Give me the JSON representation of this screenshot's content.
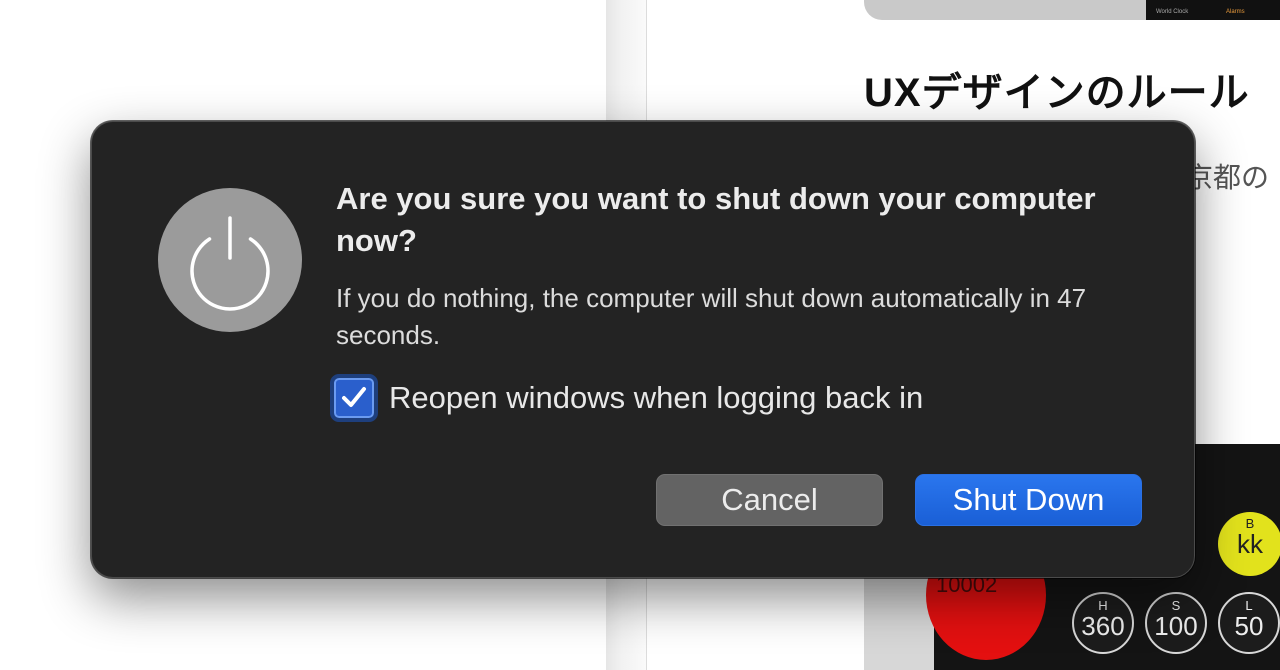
{
  "background": {
    "title": "UXデザインのルール",
    "body_text": "京都の",
    "phone_tabs": [
      "World Clock",
      "Alarms"
    ],
    "app_red_text": "10002",
    "app_circles": [
      {
        "label": "B",
        "value": "kk"
      },
      {
        "label": "H",
        "value": "360"
      },
      {
        "label": "S",
        "value": "100"
      },
      {
        "label": "L",
        "value": "50"
      }
    ]
  },
  "dialog": {
    "icon": "power-icon",
    "title": "Are you sure you want to shut down your computer now?",
    "message": "If you do nothing, the computer will shut down automatically in 47 seconds.",
    "checkbox": {
      "label": "Reopen windows when logging back in",
      "checked": true
    },
    "buttons": {
      "cancel": "Cancel",
      "confirm": "Shut Down"
    }
  },
  "colors": {
    "dialog_bg": "#232323",
    "accent": "#1f69e0",
    "cancel_bg": "#636363",
    "icon_bg": "#9b9b9b"
  }
}
